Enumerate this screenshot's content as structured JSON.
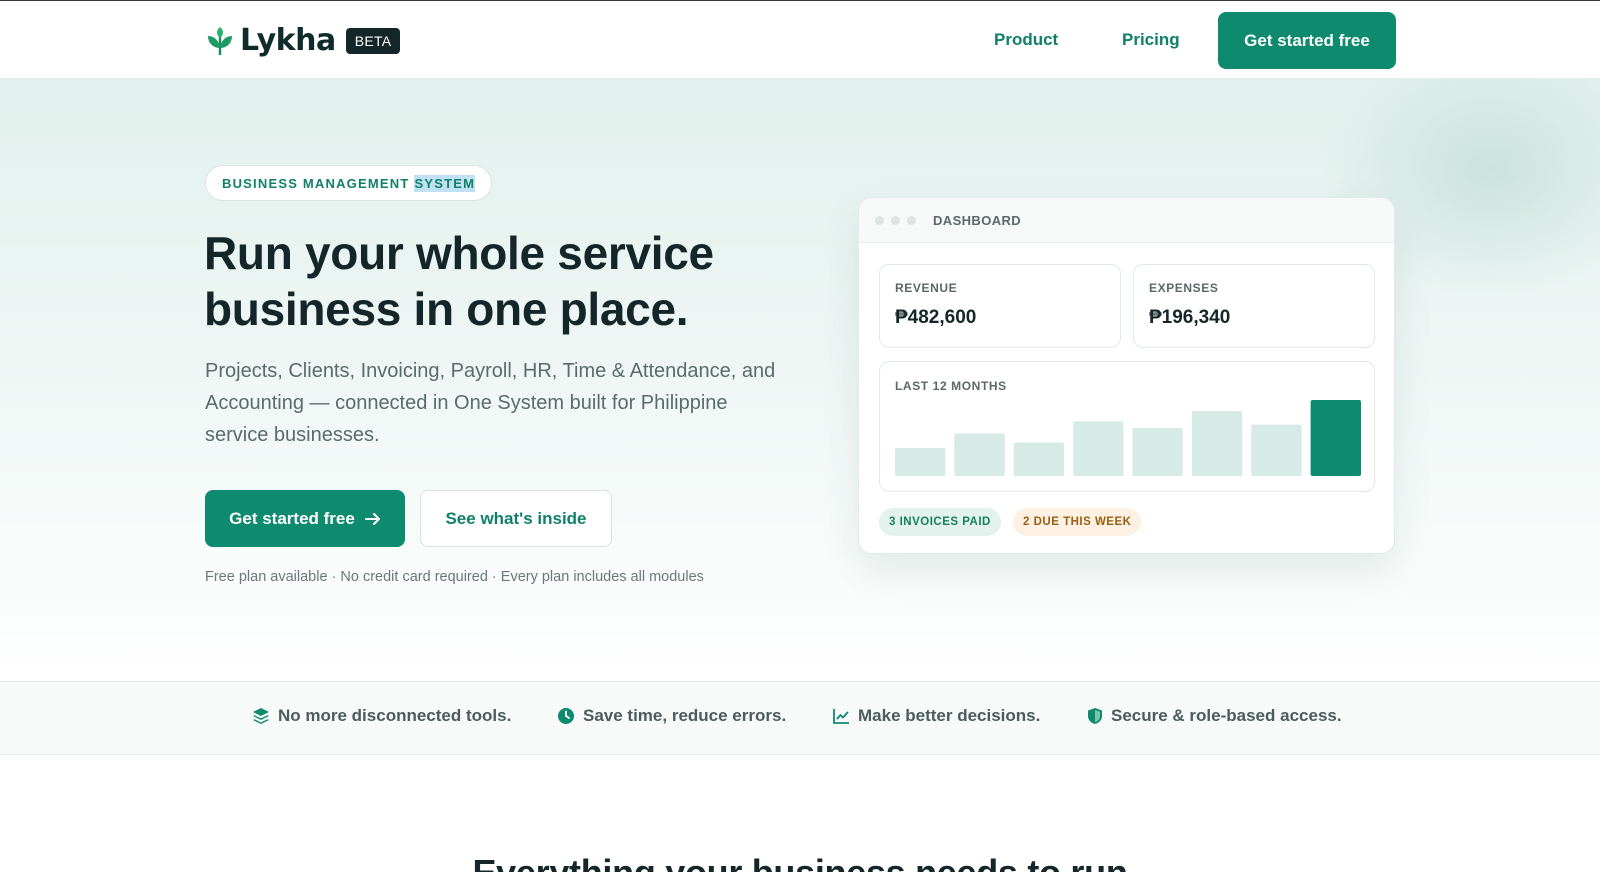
{
  "header": {
    "brand": "Lykha",
    "beta_label": "BETA",
    "nav": [
      {
        "label": "Product"
      },
      {
        "label": "Pricing"
      }
    ],
    "cta_label": "Get started free"
  },
  "hero": {
    "pill_text": "BUSINESS MANAGEMENT",
    "pill_selected": "SYSTEM",
    "headline": "Run your whole service business in one place.",
    "subtext": "Projects, Clients, Invoicing, Payroll, HR, Time & Attendance, and Accounting — connected in One System built for Philippine service businesses.",
    "cta_primary": "Get started free",
    "cta_secondary": "See what's inside",
    "fineprint": "Free plan available · No credit card required · Every plan includes all modules"
  },
  "dashboard": {
    "title": "DASHBOARD",
    "revenue_label": "REVENUE",
    "revenue_value": "₱482,600",
    "expenses_label": "EXPENSES",
    "expenses_value": "₱196,340",
    "chart_label": "LAST 12 MONTHS",
    "badge_paid": "3 INVOICES PAID",
    "badge_due": "2 DUE THIS WEEK",
    "colors": {
      "bar": "#d6ebe6",
      "bar_highlight": "#0e8a6f"
    }
  },
  "chart_data": {
    "type": "bar",
    "title": "LAST 12 MONTHS",
    "values": [
      25,
      38,
      30,
      49,
      43,
      58,
      46,
      68
    ],
    "highlight_last": true
  },
  "features": [
    {
      "icon": "layers-icon",
      "label": "No more disconnected tools."
    },
    {
      "icon": "clock-icon",
      "label": "Save time, reduce errors."
    },
    {
      "icon": "line-chart-icon",
      "label": "Make better decisions."
    },
    {
      "icon": "shield-icon",
      "label": "Secure & role-based access."
    }
  ],
  "next_section": {
    "title": "Everything your business needs to run"
  },
  "theme": {
    "accent": "#0e8a6f",
    "ink": "#15262a"
  }
}
